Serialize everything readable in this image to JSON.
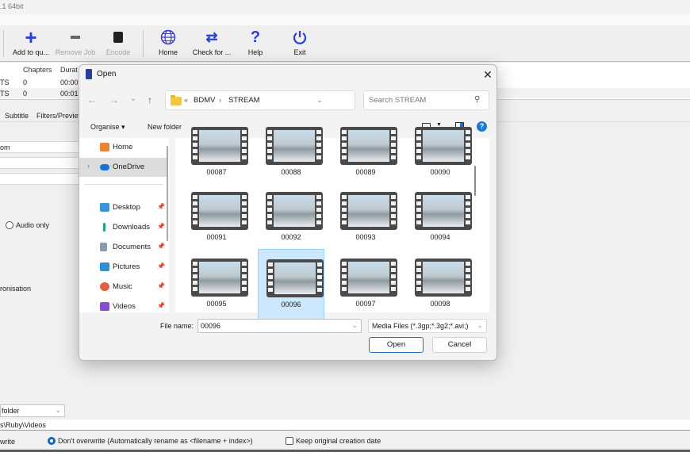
{
  "app": {
    "title_fragment": ".1 64bit",
    "toolbar": [
      {
        "label": "Add to qu...",
        "icon": "plus-icon",
        "enabled": true
      },
      {
        "label": "Remove Job",
        "icon": "minus-icon",
        "enabled": false
      },
      {
        "label": "Encode",
        "icon": "encode-icon",
        "enabled": false
      },
      {
        "label": "Home",
        "icon": "globe-icon",
        "enabled": true
      },
      {
        "label": "Check for ...",
        "icon": "refresh-arrows-icon",
        "enabled": true
      },
      {
        "label": "Help",
        "icon": "question-icon",
        "enabled": true
      },
      {
        "label": "Exit",
        "icon": "power-icon",
        "enabled": true
      }
    ],
    "job_table": {
      "columns": [
        "Chapters",
        "Durat"
      ],
      "rows": [
        {
          "type": "TS",
          "chapters": "0",
          "duration": "00:00"
        },
        {
          "type": "TS",
          "chapters": "0",
          "duration": "00:01"
        }
      ]
    },
    "tabs": [
      "Subtitle",
      "Filters/Preview"
    ],
    "fields": {
      "field1": "om",
      "audio_only_label": "Audio only",
      "sync_label": "ronisation"
    },
    "output": {
      "folder_combo": "folder",
      "path": "s\\Ruby\\Videos",
      "overwrite_label": "write",
      "dont_overwrite_label": "Don't overwrite (Automatically rename as <filename + index>)",
      "dont_overwrite_selected": true,
      "keep_date_label": "Keep original creation date",
      "keep_date_checked": false
    }
  },
  "dialog": {
    "title": "Open",
    "close_icon": "close-icon",
    "nav": {
      "back": "←",
      "forward": "→",
      "recent": "⌄",
      "up": "↑"
    },
    "address": {
      "overflow": "«",
      "crumbs": [
        "BDMV",
        "STREAM"
      ],
      "separator": "›"
    },
    "search_placeholder": "Search STREAM",
    "commands": {
      "organise": "Organise ▾",
      "new_folder": "New folder"
    },
    "nav_pane": [
      {
        "label": "Home",
        "icon": "home-icon",
        "color": "#e8833a",
        "pinned": false,
        "selected": false
      },
      {
        "label": "OneDrive",
        "icon": "cloud-icon",
        "color": "#1a73d0",
        "pinned": false,
        "selected": true,
        "expandable": true
      },
      {
        "label": "Desktop",
        "icon": "desktop-icon",
        "color": "#3a95d8",
        "pinned": true,
        "selected": false
      },
      {
        "label": "Downloads",
        "icon": "download-icon",
        "color": "#2aa56a",
        "pinned": true,
        "selected": false
      },
      {
        "label": "Documents",
        "icon": "documents-icon",
        "color": "#8a9bb0",
        "pinned": true,
        "selected": false
      },
      {
        "label": "Pictures",
        "icon": "pictures-icon",
        "color": "#2d8fd6",
        "pinned": true,
        "selected": false
      },
      {
        "label": "Music",
        "icon": "music-icon",
        "color": "#e06040",
        "pinned": true,
        "selected": false
      },
      {
        "label": "Videos",
        "icon": "videos-icon",
        "color": "#8a4ad8",
        "pinned": true,
        "selected": false
      }
    ],
    "files": [
      {
        "name": "00087",
        "selected": false
      },
      {
        "name": "00088",
        "selected": false
      },
      {
        "name": "00089",
        "selected": false
      },
      {
        "name": "00090",
        "selected": false
      },
      {
        "name": "00091",
        "selected": false
      },
      {
        "name": "00092",
        "selected": false
      },
      {
        "name": "00093",
        "selected": false
      },
      {
        "name": "00094",
        "selected": false
      },
      {
        "name": "00095",
        "selected": false
      },
      {
        "name": "00096",
        "selected": true
      },
      {
        "name": "00097",
        "selected": false
      },
      {
        "name": "00098",
        "selected": false
      }
    ],
    "filename_label": "File name:",
    "filename_value": "00096",
    "filetype": "Media Files (*.3gp;*.3g2;*.avi;)",
    "open_label": "Open",
    "cancel_label": "Cancel"
  }
}
